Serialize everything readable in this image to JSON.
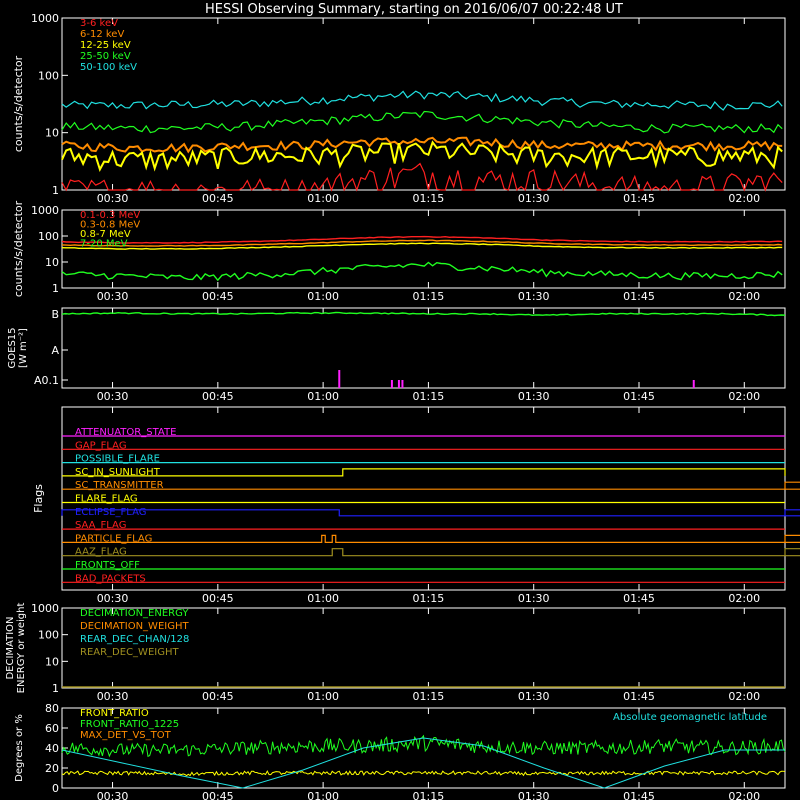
{
  "title": "HESSI Observing Summary, starting on 2016/06/07 00:22:48 UT",
  "time_labels": [
    "00:30",
    "00:45",
    "01:00",
    "01:15",
    "01:30",
    "01:45",
    "02:00"
  ],
  "colors": {
    "red": "#ff2020",
    "orange": "#ff8c00",
    "yellow": "#ffff00",
    "green": "#20ff20",
    "cyan": "#20e0e0",
    "magenta": "#ff20ff",
    "blue": "#2020ff",
    "olive": "#a09020",
    "axis": "#ffffff"
  },
  "chart_data": [
    {
      "type": "line",
      "id": "lowE",
      "ylabel": "counts/s/detector",
      "y_scale": "log",
      "ylim": [
        1,
        1000
      ],
      "y_ticks": [
        "1",
        "10",
        "100",
        "1000"
      ],
      "legend": [
        "3-6 keV",
        "6-12 keV",
        "12-25 keV",
        "25-50 keV",
        "50-100 keV"
      ],
      "series": [
        {
          "name": "50-100 keV",
          "color": "cyan",
          "values": [
            30,
            30,
            31,
            32,
            36,
            42,
            47,
            42,
            36,
            32,
            31,
            30,
            31
          ]
        },
        {
          "name": "25-50 keV",
          "color": "green",
          "values": [
            13,
            12,
            12,
            13,
            15,
            18,
            21,
            18,
            15,
            13,
            12,
            12,
            12
          ]
        },
        {
          "name": "6-12 keV",
          "color": "orange",
          "values": [
            6,
            5.5,
            5.5,
            6,
            6,
            7,
            7,
            7,
            6,
            6,
            6,
            6,
            6
          ]
        },
        {
          "name": "12-25 keV",
          "color": "yellow",
          "values": [
            4,
            3.5,
            3.5,
            4,
            4,
            4.5,
            5,
            4.5,
            4,
            4,
            4,
            4,
            4
          ]
        },
        {
          "name": "3-6 keV",
          "color": "red",
          "values": [
            1,
            1,
            1,
            1,
            1,
            1.5,
            2,
            1.5,
            1.5,
            1.2,
            1,
            1.2,
            1.5
          ]
        }
      ]
    },
    {
      "type": "line",
      "id": "highE",
      "ylabel": "counts/s/detector",
      "y_scale": "log",
      "ylim": [
        1,
        1000
      ],
      "y_ticks": [
        "1",
        "10",
        "100",
        "1000"
      ],
      "legend": [
        "0.1-0.3 MeV",
        "0.3-0.8 MeV",
        "0.8-7 MeV",
        "7-20 MeV"
      ],
      "series": [
        {
          "name": "0.1-0.3 MeV",
          "color": "red",
          "values": [
            60,
            55,
            55,
            60,
            70,
            85,
            95,
            85,
            70,
            62,
            60,
            60,
            62
          ]
        },
        {
          "name": "0.3-0.8 MeV",
          "color": "orange",
          "values": [
            45,
            42,
            42,
            45,
            52,
            62,
            68,
            62,
            52,
            47,
            45,
            45,
            46
          ]
        },
        {
          "name": "0.8-7 MeV",
          "color": "yellow",
          "values": [
            35,
            32,
            32,
            35,
            40,
            48,
            52,
            48,
            40,
            36,
            35,
            35,
            36
          ]
        },
        {
          "name": "7-20 MeV",
          "color": "green",
          "values": [
            3.5,
            3,
            2.5,
            3,
            4,
            6,
            8,
            6,
            4,
            3.5,
            3,
            3,
            3.5
          ]
        }
      ]
    },
    {
      "type": "line",
      "id": "goes",
      "ylabel": "GOES15",
      "ylabel2": "[W m⁻²]",
      "y_ticks": [
        "A0.1",
        "A",
        "B"
      ],
      "series": [
        {
          "name": "GOES long",
          "color": "green",
          "values": [
            0.95,
            0.96,
            0.95,
            0.95,
            0.96,
            0.96,
            0.95,
            0.95,
            0.93,
            0.95,
            0.95,
            0.95,
            0.93
          ]
        }
      ],
      "spikes_minutes": [
        39.5,
        47,
        48,
        48.5,
        90,
        118
      ]
    },
    {
      "type": "table",
      "id": "flags",
      "ylabel": "Flags",
      "flags": [
        {
          "name": "ATTENUATOR_STATE",
          "color": "magenta",
          "segments": []
        },
        {
          "name": "GAP_FLAG",
          "color": "red",
          "segments": []
        },
        {
          "name": "POSSIBLE_FLARE",
          "color": "cyan",
          "segments": []
        },
        {
          "name": "SC_IN_SUNLIGHT",
          "color": "yellow",
          "segments": [
            [
              40,
              117.5
            ]
          ]
        },
        {
          "name": "SC_TRANSMITTER",
          "color": "orange",
          "segments": [
            [
              116,
              128
            ]
          ]
        },
        {
          "name": "FLARE_FLAG",
          "color": "yellow",
          "segments": []
        },
        {
          "name": "ECLIPSE_FLAG",
          "color": "blue",
          "segments": [
            [
              0,
              39.5
            ],
            [
              117.5,
              150
            ]
          ]
        },
        {
          "name": "SAA_FLAG",
          "color": "red",
          "segments": []
        },
        {
          "name": "PARTICLE_FLAG",
          "color": "orange",
          "segments": [
            [
              37,
              37.5
            ],
            [
              38.5,
              39
            ],
            [
              136,
              136.5
            ],
            [
              137,
              137.5
            ]
          ]
        },
        {
          "name": "AAZ_FLAG",
          "color": "olive",
          "segments": [
            [
              38.5,
              40
            ],
            [
              116,
              117.5
            ]
          ]
        },
        {
          "name": "FRONTS_OFF",
          "color": "green",
          "segments": []
        },
        {
          "name": "BAD_PACKETS",
          "color": "red",
          "segments": []
        }
      ]
    },
    {
      "type": "line",
      "id": "decim",
      "ylabel": "DECIMATION",
      "ylabel2": "ENERGY or weight",
      "y_scale": "log",
      "ylim": [
        1,
        1000
      ],
      "y_ticks": [
        "1",
        "10",
        "100",
        "1000"
      ],
      "legend": [
        "DECIMATION_ENERGY",
        "DECIMATION_WEIGHT",
        "REAR_DEC_CHAN/128",
        "REAR_DEC_WEIGHT"
      ],
      "series": [
        {
          "name": "REAR_DEC_WEIGHT",
          "color": "olive",
          "values": [
            1,
            1,
            1,
            1,
            1,
            1,
            1,
            1,
            1,
            1,
            1,
            1,
            1
          ]
        }
      ]
    },
    {
      "type": "line",
      "id": "ratio",
      "ylabel": "Degrees or %",
      "ylim": [
        0,
        80
      ],
      "y_ticks": [
        "0",
        "20",
        "40",
        "60",
        "80"
      ],
      "legend": [
        "FRONT_RATIO",
        "FRONT_RATIO_1225",
        "MAX_DET_VS_TOT"
      ],
      "annotation": "Absolute geomagnetic latitude",
      "series": [
        {
          "name": "FRONT_RATIO_1225",
          "color": "green",
          "values": [
            40,
            38,
            38,
            40,
            42,
            42,
            45,
            42,
            40,
            40,
            42,
            40,
            42
          ]
        },
        {
          "name": "FRONT_RATIO",
          "color": "yellow",
          "values": [
            15,
            15,
            14,
            15,
            15,
            15,
            15,
            15,
            14,
            15,
            15,
            15,
            15
          ]
        },
        {
          "name": "Absolute geomagnetic latitude",
          "color": "cyan",
          "values": [
            38,
            25,
            12,
            0,
            18,
            40,
            50,
            42,
            20,
            0,
            22,
            38,
            38
          ]
        }
      ]
    }
  ]
}
